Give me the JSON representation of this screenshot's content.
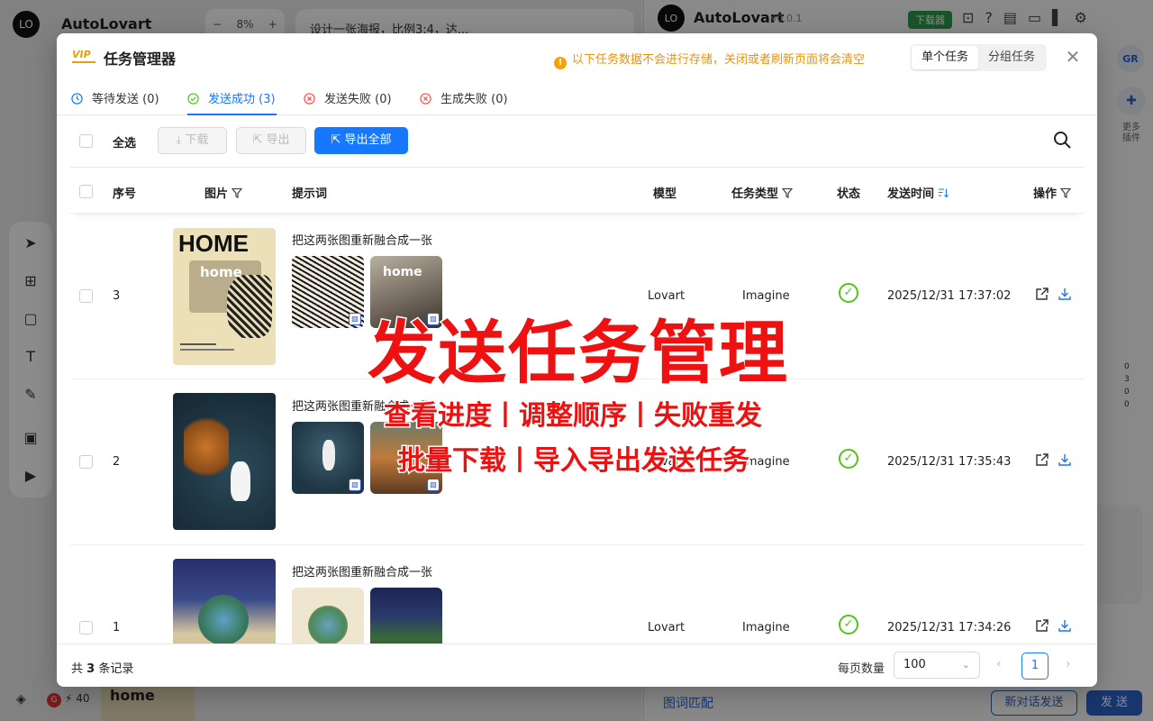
{
  "background": {
    "app_title": "AutoLovart",
    "zoom": "8%",
    "doc_title": "设计一张海报，比例3:4，达...",
    "right_title": "AutoLovart",
    "right_version": "v0.0.1",
    "download_badge": "下载器",
    "avatar": "GR",
    "plugins_label": "更多插件",
    "image_match": "图词匹配",
    "new_chat_send": "新对话发送",
    "send": "发 送",
    "credits": "40",
    "credit_letter": "G",
    "stats": [
      "0",
      "3",
      "0",
      "0"
    ],
    "thumb_text": "home"
  },
  "modal": {
    "vip": "VIP",
    "title": "任务管理器",
    "warning": "以下任务数据不会进行存储，关闭或者刷新页面将会清空",
    "segments": [
      "单个任务",
      "分组任务"
    ],
    "tabs": [
      {
        "label": "等待发送 (0)",
        "icon": "clock-icon",
        "color": "#1677ff"
      },
      {
        "label": "发送成功 (3)",
        "icon": "check-circle-icon",
        "color": "#52c41a"
      },
      {
        "label": "发送失败 (0)",
        "icon": "x-circle-icon",
        "color": "#ff4d4f"
      },
      {
        "label": "生成失败 (0)",
        "icon": "x-circle-icon",
        "color": "#ff4d4f"
      }
    ],
    "toolbar": {
      "select_all": "全选",
      "download": "下载",
      "export": "导出",
      "export_all": "导出全部"
    },
    "columns": {
      "index": "序号",
      "image": "图片",
      "prompt": "提示词",
      "model": "模型",
      "task_type": "任务类型",
      "status": "状态",
      "send_time": "发送时间",
      "actions": "操作"
    },
    "rows": [
      {
        "index": "3",
        "prompt": "把这两张图重新融合成一张",
        "model": "Lovart",
        "task_type": "Imagine",
        "status": "success",
        "send_time": "2025/12/31 17:37:02",
        "poster_text": "HOME",
        "poster_sub": "home"
      },
      {
        "index": "2",
        "prompt": "把这两张图重新融合成一张",
        "model": "Lovart",
        "task_type": "Imagine",
        "status": "success",
        "send_time": "2025/12/31 17:35:43"
      },
      {
        "index": "1",
        "prompt": "把这两张图重新融合成一张",
        "model": "Lovart",
        "task_type": "Imagine",
        "status": "success",
        "send_time": "2025/12/31 17:34:26"
      }
    ],
    "footer": {
      "total_prefix": "共",
      "total_count": "3",
      "total_suffix": "条记录",
      "page_size_label": "每页数量",
      "page_size": "100",
      "current_page": "1"
    }
  },
  "promo": {
    "title": "发送任务管理",
    "line1": "查看进度丨调整顺序丨失败重发",
    "line2": "批量下载丨导入导出发送任务"
  },
  "colors": {
    "primary": "#1677ff",
    "success": "#52c41a",
    "error": "#ff4d4f",
    "warning": "#e8930c",
    "promo": "#ee1111"
  }
}
